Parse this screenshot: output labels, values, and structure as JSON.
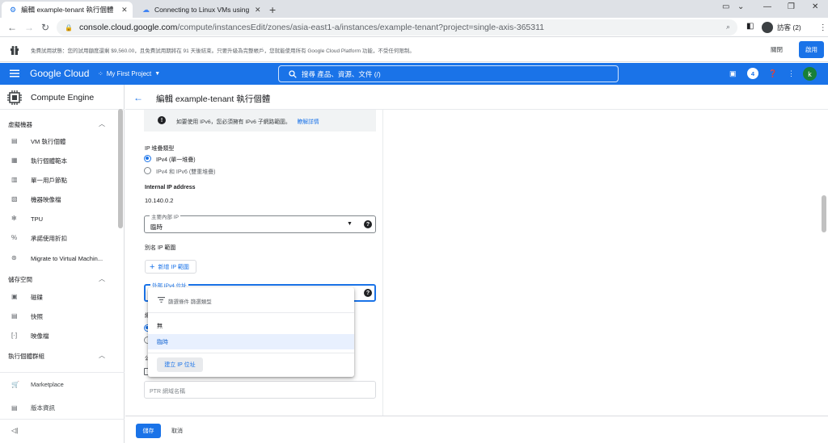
{
  "browser": {
    "tabs": [
      {
        "title": "編輯 example-tenant 執行個體",
        "close": "✕"
      },
      {
        "title": "Connecting to Linux VMs using",
        "close": "✕"
      }
    ],
    "new_tab": "+",
    "url_domain": "console.cloud.google.com",
    "url_path": "/compute/instancesEdit/zones/asia-east1-a/instances/example-tenant?project=single-axis-365311",
    "profile_label": "訪客 (2)"
  },
  "trial_banner": {
    "text": "免費試用狀態：您的試用額度還剩 $9,560.00，且免費試用期將在 91 天後結束。只要升級為完整帳戶，您就能使用所有 Google Cloud Platform 功能，不受任何限制。",
    "dismiss": "關閉",
    "activate": "啟用"
  },
  "header": {
    "logo": "Google Cloud",
    "project": "My First Project",
    "search_placeholder": "搜尋 產品、資源、文件 (/)",
    "notification_count": "4",
    "avatar_letter": "k",
    "brand_color": "#1a73e8"
  },
  "sidebar": {
    "product": "Compute Engine",
    "sections": [
      {
        "label": "虛擬機器",
        "items": [
          "VM 執行個體",
          "執行個體範本",
          "單一用戶節點",
          "機器映像檔",
          "TPU",
          "承諾使用折扣",
          "Migrate to Virtual Machin..."
        ]
      },
      {
        "label": "儲存空間",
        "items": [
          "磁碟",
          "快照",
          "映像檔"
        ]
      },
      {
        "label": "執行個體群組",
        "items": []
      }
    ],
    "bottom": [
      "Marketplace",
      "版本資訊"
    ],
    "collapse": "◁|"
  },
  "page": {
    "title": "編輯 example-tenant 執行個體",
    "info_text": "如要使用 IPv6，您必須擁有 IPv6 子網路範圍。",
    "info_link": "瞭解詳情",
    "ip_stack_label": "IP 堆疊類型",
    "ip_stack_options": [
      "IPv4 (單一堆疊)",
      "IPv4 和 IPv6 (雙重堆疊)"
    ],
    "internal_ip_label": "Internal IP address",
    "internal_ip_value": "10.140.0.2",
    "primary_ip_field_label": "主要內部 IP",
    "primary_ip_value": "臨時",
    "alias_label": "別名 IP 範圍",
    "add_alias_button": "新增 IP 範圍",
    "external_ip_field_label": "外部 IPv4 位址",
    "ptr_placeholder": "PTR 網域名稱",
    "save": "儲存",
    "cancel": "取消"
  },
  "dropdown": {
    "filter_text": "篩選條件 篩選類型",
    "options": [
      "無",
      "臨時"
    ],
    "selected": "臨時",
    "create_button": "建立 IP 位址"
  }
}
